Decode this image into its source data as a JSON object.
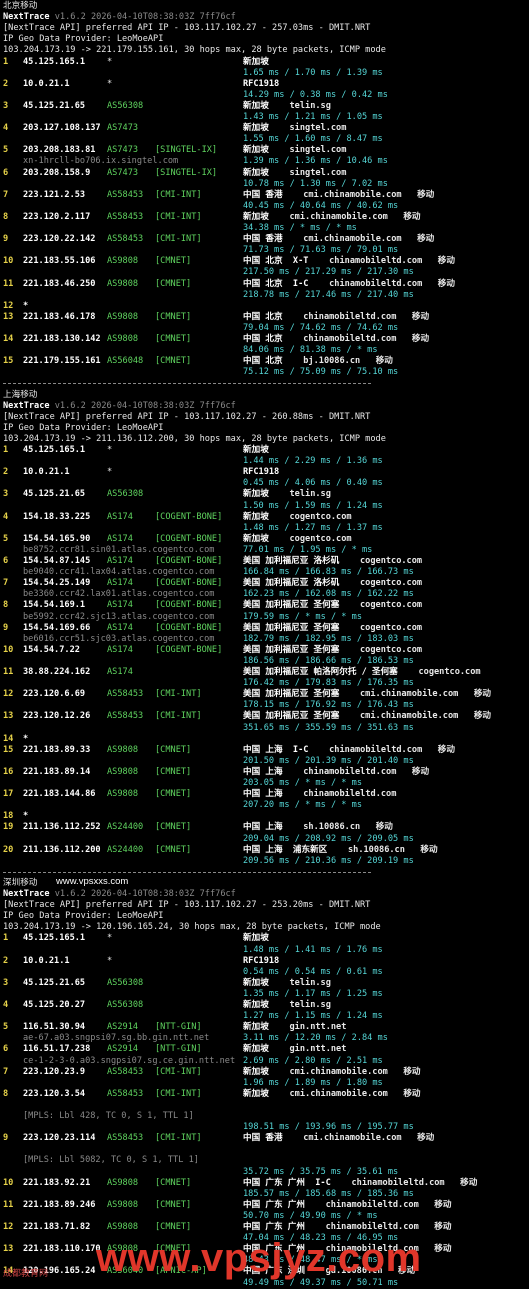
{
  "header": {
    "tool": "NextTrace",
    "version": "v1.6.2 2026-04-10T08:38:03Z 7ff76cf",
    "geo": "IP Geo Data Provider: LeoMoeAPI"
  },
  "sections": [
    {
      "title": "北京移动",
      "api": "[NextTrace API] preferred API IP - 103.117.102.27 - 257.03ms - DMIT.NRT",
      "route": "103.204.173.19 -> 221.179.155.161, 30 hops max, 28 byte packets, ICMP mode",
      "hops": [
        {
          "n": "1",
          "ip": "45.125.165.1",
          "asn": "*",
          "tag": "",
          "loc": "新加坡",
          "host": "",
          "isp": "",
          "rtt": "1.65 ms / 1.70 ms / 1.39 ms"
        },
        {
          "n": "2",
          "ip": "10.0.21.1",
          "asn": "*",
          "tag": "",
          "loc": "RFC1918",
          "host": "",
          "isp": "",
          "rtt": "14.29 ms / 0.38 ms / 0.42 ms"
        },
        {
          "n": "3",
          "ip": "45.125.21.65",
          "asn": "AS56308",
          "tag": "",
          "loc": "新加坡",
          "host": "telin.sg",
          "isp": "",
          "rtt": "1.43 ms / 1.21 ms / 1.05 ms"
        },
        {
          "n": "4",
          "ip": "203.127.108.137",
          "asn": "AS7473",
          "tag": "",
          "loc": "新加坡",
          "host": "singtel.com",
          "isp": "",
          "rtt": "1.55 ms / 1.60 ms / 8.47 ms"
        },
        {
          "n": "5",
          "ip": "203.208.183.81",
          "asn": "AS7473",
          "tag": "[SINGTEL-IX]",
          "loc": "新加坡",
          "host": "singtel.com",
          "isp": "",
          "rdns": "xn-1hrcll-bo706.ix.singtel.com",
          "rtt": "1.39 ms / 1.36 ms / 10.46 ms"
        },
        {
          "n": "6",
          "ip": "203.208.158.9",
          "asn": "AS7473",
          "tag": "[SINGTEL-IX]",
          "loc": "新加坡",
          "host": "singtel.com",
          "isp": "",
          "rtt": "10.78 ms / 1.30 ms / 7.02 ms"
        },
        {
          "n": "7",
          "ip": "223.121.2.53",
          "asn": "AS58453",
          "tag": "[CMI-INT]",
          "loc": "中国 香港",
          "host": "cmi.chinamobile.com",
          "isp": "移动",
          "rtt": "40.45 ms / 40.64 ms / 40.62 ms"
        },
        {
          "n": "8",
          "ip": "223.120.2.117",
          "asn": "AS58453",
          "tag": "[CMI-INT]",
          "loc": "新加坡",
          "host": "cmi.chinamobile.com",
          "isp": "移动",
          "rtt": "34.38 ms / * ms / * ms"
        },
        {
          "n": "9",
          "ip": "223.120.22.142",
          "asn": "AS58453",
          "tag": "[CMI-INT]",
          "loc": "中国 香港",
          "host": "cmi.chinamobile.com",
          "isp": "移动",
          "rtt": "71.73 ms / 71.63 ms / 79.01 ms"
        },
        {
          "n": "10",
          "ip": "221.183.55.106",
          "asn": "AS9808",
          "tag": "[CMNET]",
          "loc": "中国 北京  X-T",
          "host": "chinamobileltd.com",
          "isp": "移动",
          "rtt": "217.50 ms / 217.29 ms / 217.30 ms"
        },
        {
          "n": "11",
          "ip": "221.183.46.250",
          "asn": "AS9808",
          "tag": "[CMNET]",
          "loc": "中国 北京  I-C",
          "host": "chinamobileltd.com",
          "isp": "移动",
          "rtt": "218.78 ms / 217.46 ms / 217.40 ms"
        },
        {
          "n": "12",
          "ip": "*",
          "asn": "",
          "tag": "",
          "loc": "",
          "host": "",
          "isp": "",
          "rtt": ""
        },
        {
          "n": "13",
          "ip": "221.183.46.178",
          "asn": "AS9808",
          "tag": "[CMNET]",
          "loc": "中国 北京",
          "host": "chinamobileltd.com",
          "isp": "移动",
          "rtt": "79.04 ms / 74.62 ms / 74.62 ms"
        },
        {
          "n": "14",
          "ip": "221.183.130.142",
          "asn": "AS9808",
          "tag": "[CMNET]",
          "loc": "中国 北京",
          "host": "chinamobileltd.com",
          "isp": "移动",
          "rtt": "84.06 ms / 81.38 ms / * ms"
        },
        {
          "n": "15",
          "ip": "221.179.155.161",
          "asn": "AS56048",
          "tag": "[CMNET]",
          "loc": "中国 北京",
          "host": "bj.10086.cn",
          "isp": "移动",
          "rtt": "75.12 ms / 75.09 ms / 75.10 ms"
        }
      ]
    },
    {
      "title": "上海移动",
      "api": "[NextTrace API] preferred API IP - 103.117.102.27 - 260.88ms - DMIT.NRT",
      "route": "103.204.173.19 -> 211.136.112.200, 30 hops max, 28 byte packets, ICMP mode",
      "hops": [
        {
          "n": "1",
          "ip": "45.125.165.1",
          "asn": "*",
          "tag": "",
          "loc": "新加坡",
          "host": "",
          "isp": "",
          "rtt": "1.44 ms / 2.29 ms / 1.36 ms"
        },
        {
          "n": "2",
          "ip": "10.0.21.1",
          "asn": "*",
          "tag": "",
          "loc": "RFC1918",
          "host": "",
          "isp": "",
          "rtt": "0.45 ms / 4.06 ms / 0.40 ms"
        },
        {
          "n": "3",
          "ip": "45.125.21.65",
          "asn": "AS56308",
          "tag": "",
          "loc": "新加坡",
          "host": "telin.sg",
          "isp": "",
          "rtt": "1.50 ms / 1.59 ms / 1.24 ms"
        },
        {
          "n": "4",
          "ip": "154.18.33.225",
          "asn": "AS174",
          "tag": "[COGENT-BONE]",
          "loc": "新加坡",
          "host": "cogentco.com",
          "isp": "",
          "rtt": "1.48 ms / 1.27 ms / 1.37 ms"
        },
        {
          "n": "5",
          "ip": "154.54.165.90",
          "asn": "AS174",
          "tag": "[COGENT-BONE]",
          "loc": "新加坡",
          "host": "cogentco.com",
          "isp": "",
          "rdns": "be8752.ccr81.sin01.atlas.cogentco.com",
          "rtt": "77.01 ms / 1.95 ms / * ms"
        },
        {
          "n": "6",
          "ip": "154.54.87.145",
          "asn": "AS174",
          "tag": "[COGENT-BONE]",
          "loc": "美国 加利福尼亚 洛杉矶",
          "host": "cogentco.com",
          "isp": "",
          "rdns": "be9040.ccr41.lax04.atlas.cogentco.com",
          "rtt": "166.84 ms / 166.83 ms / 166.73 ms"
        },
        {
          "n": "7",
          "ip": "154.54.25.149",
          "asn": "AS174",
          "tag": "[COGENT-BONE]",
          "loc": "美国 加利福尼亚 洛杉矶",
          "host": "cogentco.com",
          "isp": "",
          "rdns": "be3360.ccr42.lax01.atlas.cogentco.com",
          "rtt": "162.23 ms / 162.08 ms / 162.22 ms"
        },
        {
          "n": "8",
          "ip": "154.54.169.1",
          "asn": "AS174",
          "tag": "[COGENT-BONE]",
          "loc": "美国 加利福尼亚 圣何塞",
          "host": "cogentco.com",
          "isp": "",
          "rdns": "be5992.ccr42.sjc13.atlas.cogentco.com",
          "rtt": "179.59 ms / * ms / * ms"
        },
        {
          "n": "9",
          "ip": "154.54.169.66",
          "asn": "AS174",
          "tag": "[COGENT-BONE]",
          "loc": "美国 加利福尼亚 圣何塞",
          "host": "cogentco.com",
          "isp": "",
          "rdns": "be6016.ccr51.sjc03.atlas.cogentco.com",
          "rtt": "182.79 ms / 182.95 ms / 183.03 ms"
        },
        {
          "n": "10",
          "ip": "154.54.7.22",
          "asn": "AS174",
          "tag": "[COGENT-BONE]",
          "loc": "美国 加利福尼亚 圣何塞",
          "host": "cogentco.com",
          "isp": "",
          "rtt": "186.56 ms / 186.66 ms / 186.53 ms"
        },
        {
          "n": "11",
          "ip": "38.88.224.162",
          "asn": "AS174",
          "tag": "",
          "loc": "美国 加利福尼亚 帕洛阿尔托 / 圣何塞",
          "host": "cogentco.com",
          "isp": "",
          "rtt": "176.42 ms / 179.83 ms / 176.35 ms"
        },
        {
          "n": "12",
          "ip": "223.120.6.69",
          "asn": "AS58453",
          "tag": "[CMI-INT]",
          "loc": "美国 加利福尼亚 圣何塞",
          "host": "cmi.chinamobile.com",
          "isp": "移动",
          "rtt": "178.15 ms / 176.92 ms / 176.43 ms"
        },
        {
          "n": "13",
          "ip": "223.120.12.26",
          "asn": "AS58453",
          "tag": "[CMI-INT]",
          "loc": "美国 加利福尼亚 圣何塞",
          "host": "cmi.chinamobile.com",
          "isp": "移动",
          "rtt": "351.65 ms / 355.59 ms / 351.63 ms"
        },
        {
          "n": "14",
          "ip": "*",
          "asn": "",
          "tag": "",
          "loc": "",
          "host": "",
          "isp": "",
          "rtt": ""
        },
        {
          "n": "15",
          "ip": "221.183.89.33",
          "asn": "AS9808",
          "tag": "[CMNET]",
          "loc": "中国 上海  I-C",
          "host": "chinamobileltd.com",
          "isp": "移动",
          "rtt": "201.50 ms / 201.39 ms / 201.40 ms"
        },
        {
          "n": "16",
          "ip": "221.183.89.14",
          "asn": "AS9808",
          "tag": "[CMNET]",
          "loc": "中国 上海",
          "host": "chinamobileltd.com",
          "isp": "移动",
          "rtt": "203.05 ms / * ms / * ms"
        },
        {
          "n": "17",
          "ip": "221.183.144.86",
          "asn": "AS9808",
          "tag": "[CMNET]",
          "loc": "中国 上海",
          "host": "chinamobileltd.com",
          "isp": "",
          "rtt": "207.20 ms / * ms / * ms"
        },
        {
          "n": "18",
          "ip": "*",
          "asn": "",
          "tag": "",
          "loc": "",
          "host": "",
          "isp": "",
          "rtt": ""
        },
        {
          "n": "19",
          "ip": "211.136.112.252",
          "asn": "AS24400",
          "tag": "[CMNET]",
          "loc": "中国 上海",
          "host": "sh.10086.cn",
          "isp": "移动",
          "rtt": "209.04 ms / 208.92 ms / 209.05 ms"
        },
        {
          "n": "20",
          "ip": "211.136.112.200",
          "asn": "AS24400",
          "tag": "[CMNET]",
          "loc": "中国 上海  浦东新区",
          "host": "sh.10086.cn",
          "isp": "移动",
          "rtt": "209.56 ms / 210.36 ms / 209.19 ms"
        }
      ]
    },
    {
      "title": "深圳移动",
      "api": "[NextTrace API] preferred API IP - 103.117.102.27 - 253.20ms - DMIT.NRT",
      "route": "103.204.173.19 -> 120.196.165.24, 30 hops max, 28 byte packets, ICMP mode",
      "hops": [
        {
          "n": "1",
          "ip": "45.125.165.1",
          "asn": "*",
          "tag": "",
          "loc": "新加坡",
          "host": "",
          "isp": "",
          "rtt": "1.48 ms / 1.41 ms / 1.76 ms"
        },
        {
          "n": "2",
          "ip": "10.0.21.1",
          "asn": "*",
          "tag": "",
          "loc": "RFC1918",
          "host": "",
          "isp": "",
          "rtt": "0.54 ms / 0.54 ms / 0.61 ms"
        },
        {
          "n": "3",
          "ip": "45.125.21.65",
          "asn": "AS56308",
          "tag": "",
          "loc": "新加坡",
          "host": "telin.sg",
          "isp": "",
          "rtt": "1.35 ms / 1.17 ms / 1.25 ms"
        },
        {
          "n": "4",
          "ip": "45.125.20.27",
          "asn": "AS56308",
          "tag": "",
          "loc": "新加坡",
          "host": "telin.sg",
          "isp": "",
          "rtt": "1.27 ms / 1.15 ms / 1.24 ms"
        },
        {
          "n": "5",
          "ip": "116.51.30.94",
          "asn": "AS2914",
          "tag": "[NTT-GIN]",
          "loc": "新加坡",
          "host": "gin.ntt.net",
          "isp": "",
          "rdns": "ae-67.a03.sngpsi07.sg.bb.gin.ntt.net",
          "rtt": "3.11 ms / 12.20 ms / 2.84 ms"
        },
        {
          "n": "6",
          "ip": "116.51.17.238",
          "asn": "AS2914",
          "tag": "[NTT-GIN]",
          "loc": "新加坡",
          "host": "gin.ntt.net",
          "isp": "",
          "rdns": "ce-1-2-3-0.a03.sngpsi07.sg.ce.gin.ntt.net",
          "rtt": "2.69 ms / 2.80 ms / 2.51 ms"
        },
        {
          "n": "7",
          "ip": "223.120.23.9",
          "asn": "AS58453",
          "tag": "[CMI-INT]",
          "loc": "新加坡",
          "host": "cmi.chinamobile.com",
          "isp": "移动",
          "rtt": "1.96 ms / 1.89 ms / 1.80 ms"
        },
        {
          "n": "8",
          "ip": "223.120.3.54",
          "asn": "AS58453",
          "tag": "[CMI-INT]",
          "loc": "新加坡",
          "host": "cmi.chinamobile.com",
          "isp": "移动",
          "rtt": "198.51 ms / 193.96 ms / 195.77 ms",
          "mpls": "[MPLS: Lbl 428, TC 0, S 1, TTL 1]"
        },
        {
          "n": "9",
          "ip": "223.120.23.114",
          "asn": "AS58453",
          "tag": "[CMI-INT]",
          "loc": "中国 香港",
          "host": "cmi.chinamobile.com",
          "isp": "移动",
          "rtt": "35.72 ms / 35.75 ms / 35.61 ms",
          "mpls": "[MPLS: Lbl 5082, TC 0, S 1, TTL 1]"
        },
        {
          "n": "10",
          "ip": "221.183.92.21",
          "asn": "AS9808",
          "tag": "[CMNET]",
          "loc": "中国 广东 广州  I-C",
          "host": "chinamobileltd.com",
          "isp": "移动",
          "rtt": "185.57 ms / 185.68 ms / 185.36 ms"
        },
        {
          "n": "11",
          "ip": "221.183.89.246",
          "asn": "AS9808",
          "tag": "[CMNET]",
          "loc": "中国 广东 广州",
          "host": "chinamobileltd.com",
          "isp": "移动",
          "rtt": "50.70 ms / 49.90 ms / * ms"
        },
        {
          "n": "12",
          "ip": "221.183.71.82",
          "asn": "AS9808",
          "tag": "[CMNET]",
          "loc": "中国 广东 广州",
          "host": "chinamobileltd.com",
          "isp": "移动",
          "rtt": "47.04 ms / 48.23 ms / 46.95 ms"
        },
        {
          "n": "13",
          "ip": "221.183.110.170",
          "asn": "AS9808",
          "tag": "[CMNET]",
          "loc": "中国 广东 广州",
          "host": "chinamobileltd.com",
          "isp": "移动",
          "rtt": "48.43 ms / 48.47 ms / * ms"
        },
        {
          "n": "14",
          "ip": "120.196.165.24",
          "asn": "AS56040",
          "tag": "[APNIC-AP]",
          "loc": "中国 广东 深圳",
          "host": "gd.10086.cn",
          "isp": "移动",
          "rtt": "49.49 ms / 49.37 ms / 50.71 ms"
        }
      ]
    }
  ],
  "watermark": {
    "small": "www.vpsxxs.com",
    "big": "www.vpsjyz.com",
    "corner": "成都教育网"
  }
}
